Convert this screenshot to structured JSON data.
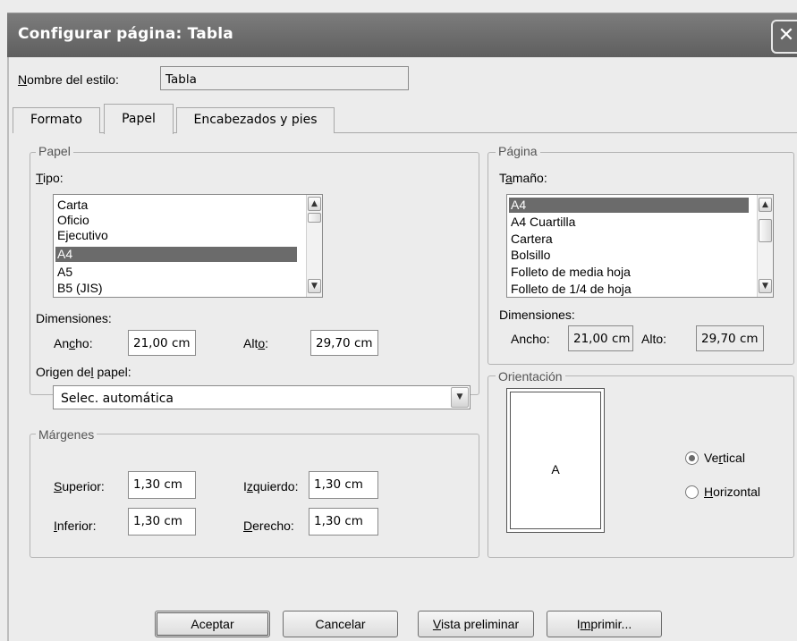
{
  "window": {
    "title": "Configurar página: Tabla",
    "close_glyph": "✕"
  },
  "style_name": {
    "label_first": "N",
    "label_rest": "ombre del estilo:",
    "value": "Tabla"
  },
  "tabs": [
    {
      "label": "Formato",
      "active": false
    },
    {
      "label": "Papel",
      "active": true
    },
    {
      "label": "Encabezados y pies",
      "active": false
    }
  ],
  "paper": {
    "legend": "Papel",
    "type_label_first": "T",
    "type_label_rest": "ipo:",
    "types": [
      "Carta",
      "Oficio",
      "Ejecutivo",
      "A4",
      "A5",
      "B5 (JIS)"
    ],
    "selected_type": "A4",
    "dimensions_label": "Dimensiones:",
    "width_label_a": "An",
    "width_label_u": "c",
    "width_label_b": "ho:",
    "width_value": "21,00 cm",
    "height_label_a": "Alt",
    "height_label_u": "o",
    "height_label_b": ":",
    "height_value": "29,70 cm",
    "source_label_a": "Origen de",
    "source_label_u": "l",
    "source_label_b": " papel:",
    "source_value": "Selec. automática"
  },
  "margins": {
    "legend": "Márgenes",
    "top_label_u": "S",
    "top_label_rest": "uperior:",
    "top_value": "1,30 cm",
    "left_label_a": "I",
    "left_label_u": "z",
    "left_label_b": "quierdo:",
    "left_value": "1,30 cm",
    "bottom_label_u": "I",
    "bottom_label_rest": "nferior:",
    "bottom_value": "1,30 cm",
    "right_label_u": "D",
    "right_label_rest": "erecho:",
    "right_value": "1,30 cm"
  },
  "page": {
    "legend": "Página",
    "size_label_a": "T",
    "size_label_u": "a",
    "size_label_b": "maño:",
    "sizes": [
      "A4",
      "A4 Cuartilla",
      "Cartera",
      "Bolsillo",
      "Folleto de media hoja",
      "Folleto de 1/4 de hoja"
    ],
    "selected_size": "A4",
    "dimensions_label": "Dimensiones:",
    "width_label": "Ancho:",
    "width_value": "21,00 cm",
    "height_label": "Alto:",
    "height_value": "29,70 cm"
  },
  "orientation": {
    "legend": "Orientación",
    "preview_letter": "A",
    "vertical_a": "Ve",
    "vertical_u": "r",
    "vertical_b": "tical",
    "horizontal_u": "H",
    "horizontal_rest": "orizontal",
    "selected": "vertical"
  },
  "buttons": {
    "ok": "Aceptar",
    "cancel": "Cancelar",
    "preview_u": "V",
    "preview_rest": "ista preliminar",
    "print_a": "I",
    "print_u": "m",
    "print_b": "primir..."
  },
  "icons": {
    "scroll_up": "▲",
    "scroll_down": "▼",
    "combo_arrow": "▼"
  }
}
